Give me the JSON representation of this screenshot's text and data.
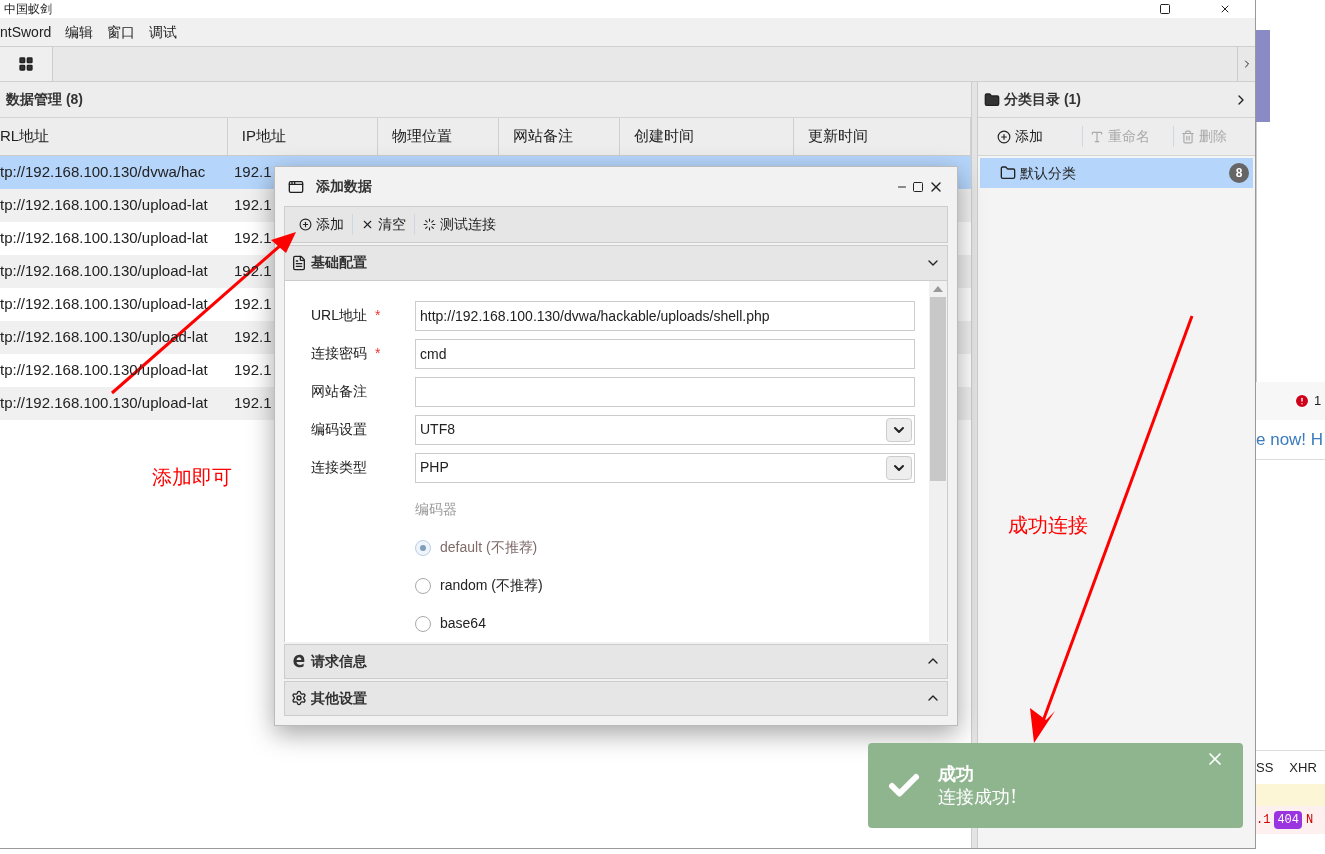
{
  "window": {
    "title": "中国蚁剑"
  },
  "menu": [
    "ntSword",
    "编辑",
    "窗口",
    "调试"
  ],
  "data_panel": {
    "title": "数据管理 (8)",
    "columns": [
      "RL地址",
      "IP地址",
      "物理位置",
      "网站备注",
      "创建时间",
      "更新时间"
    ],
    "rows": [
      {
        "url": "tp://192.168.100.130/dvwa/hac",
        "ip": "192.1",
        "selected": true
      },
      {
        "url": "tp://192.168.100.130/upload-lat",
        "ip": "192.1",
        "selected": false
      },
      {
        "url": "tp://192.168.100.130/upload-lat",
        "ip": "192.1",
        "selected": false
      },
      {
        "url": "tp://192.168.100.130/upload-lat",
        "ip": "192.1",
        "selected": false
      },
      {
        "url": "tp://192.168.100.130/upload-lat",
        "ip": "192.1",
        "selected": false
      },
      {
        "url": "tp://192.168.100.130/upload-lat",
        "ip": "192.1",
        "selected": false
      },
      {
        "url": "tp://192.168.100.130/upload-lat",
        "ip": "192.1",
        "selected": false
      },
      {
        "url": "tp://192.168.100.130/upload-lat",
        "ip": "192.1",
        "selected": false
      }
    ]
  },
  "category_panel": {
    "title": "分类目录 (1)",
    "toolbar": [
      {
        "kind": "add",
        "label": "添加",
        "disabled": false
      },
      {
        "kind": "rename",
        "label": "重命名",
        "disabled": true
      },
      {
        "kind": "delete",
        "label": "删除",
        "disabled": true
      }
    ],
    "items": [
      {
        "label": "默认分类",
        "count": "8",
        "selected": true
      }
    ]
  },
  "dialog": {
    "title": "添加数据",
    "toolbar": [
      {
        "kind": "add",
        "label": "添加"
      },
      {
        "kind": "clear",
        "label": "清空"
      },
      {
        "kind": "test",
        "label": "测试连接"
      }
    ],
    "sections": [
      {
        "kind": "basic",
        "title": "基础配置",
        "expanded": true
      },
      {
        "kind": "request",
        "title": "请求信息",
        "expanded": false
      },
      {
        "kind": "other",
        "title": "其他设置",
        "expanded": false
      }
    ],
    "fields": [
      {
        "kind": "text",
        "label": "URL地址",
        "required": true,
        "value": "http://192.168.100.130/dvwa/hackable/uploads/shell.php"
      },
      {
        "kind": "text",
        "label": "连接密码",
        "required": true,
        "value": "cmd"
      },
      {
        "kind": "text",
        "label": "网站备注",
        "required": false
      },
      {
        "kind": "select",
        "label": "编码设置",
        "required": false,
        "value": "UTF8"
      },
      {
        "kind": "select",
        "label": "连接类型",
        "required": false,
        "value": "PHP"
      }
    ],
    "required_mark": "*",
    "encoder": {
      "label": "编码器",
      "options": [
        {
          "label": "default (不推荐)",
          "selected": true
        },
        {
          "label": "random (不推荐)",
          "selected": false
        },
        {
          "label": "base64",
          "selected": false
        }
      ]
    }
  },
  "toast": {
    "title": "成功",
    "message": "连接成功!"
  },
  "annotations": [
    {
      "text": "添加即可"
    },
    {
      "text": "成功连接"
    }
  ],
  "background_page": {
    "error_count": "1",
    "link_text": "e now! H",
    "tabs": [
      "SS",
      "XHR"
    ],
    "row_text": ".1",
    "status": "404",
    "row_tail": "N"
  }
}
